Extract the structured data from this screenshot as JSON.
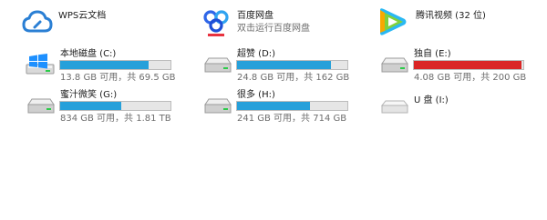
{
  "apps": [
    {
      "name": "WPS云文档",
      "subtitle": "",
      "icon": "wps-cloud-icon"
    },
    {
      "name": "百度网盘",
      "subtitle": "双击运行百度网盘",
      "icon": "baidu-netdisk-icon"
    },
    {
      "name": "腾讯视频 (32 位)",
      "subtitle": "",
      "icon": "tencent-video-icon"
    }
  ],
  "drives": [
    {
      "label": "本地磁盘 (C:)",
      "space": "13.8 GB 可用，共 69.5 GB",
      "used_fraction": 0.8,
      "icon": "windows-drive-icon"
    },
    {
      "label": "超赞 (D:)",
      "space": "24.8 GB 可用，共 162 GB",
      "used_fraction": 0.85,
      "icon": "hard-drive-icon"
    },
    {
      "label": "独自 (E:)",
      "space": "4.08 GB 可用，共 200 GB",
      "used_fraction": 0.98,
      "icon": "hard-drive-icon"
    },
    {
      "label": "蜜汁微笑 (G:)",
      "space": "834 GB 可用，共 1.81 TB",
      "used_fraction": 0.55,
      "icon": "hard-drive-icon"
    },
    {
      "label": "很多 (H:)",
      "space": "241 GB 可用，共 714 GB",
      "used_fraction": 0.66,
      "icon": "hard-drive-icon"
    },
    {
      "label": "U 盘 (I:)",
      "space": "",
      "used_fraction": null,
      "icon": "usb-drive-icon"
    }
  ],
  "colors": {
    "bar_normal": "#26a0da",
    "bar_full": "#da2626",
    "bar_track": "#e6e6e6"
  }
}
